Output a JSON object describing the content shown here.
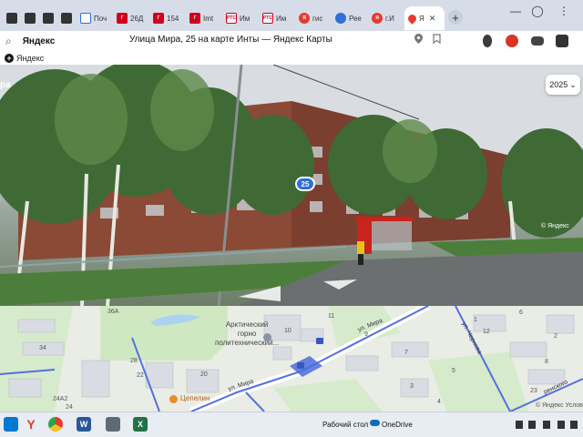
{
  "browser": {
    "tabs": [
      {
        "label": "",
        "icon": "grid-icon"
      },
      {
        "label": "",
        "icon": "grid-icon"
      },
      {
        "label": "",
        "icon": "grid-icon"
      },
      {
        "label": "",
        "icon": "grid-icon"
      },
      {
        "label": "Поч",
        "icon": "mail-icon"
      },
      {
        "label": "26Д",
        "icon": "doc-icon"
      },
      {
        "label": "154",
        "icon": "doc-icon"
      },
      {
        "label": "Imt",
        "icon": "doc-icon"
      },
      {
        "label": "Им",
        "icon": "rtc-icon"
      },
      {
        "label": "Им",
        "icon": "rtc-icon"
      },
      {
        "label": "гис",
        "icon": "yandex-icon"
      },
      {
        "label": "Рее",
        "icon": "globe-icon"
      },
      {
        "label": "г.И",
        "icon": "yandex-icon"
      }
    ],
    "active_tab": {
      "label": "Я",
      "close": "✕",
      "icon": "map-pin-icon"
    },
    "new_tab_symbol": "+",
    "window_controls": {
      "minimize": "—",
      "avatar": "◯",
      "more": "⋮"
    },
    "address": {
      "search_symbol": "⌕",
      "brand": "Яндекс",
      "title": "Улица Мира, 25 на карте Инты — Яндекс Карты"
    },
    "bookmarks": [
      {
        "label": "Яндекс"
      }
    ]
  },
  "street_view": {
    "partial_title": "ра",
    "year": "2025",
    "house_number": "25",
    "watermark": "© Яндекс"
  },
  "map": {
    "labels": [
      {
        "text": "36А"
      },
      {
        "text": "34"
      },
      {
        "text": "28"
      },
      {
        "text": "22"
      },
      {
        "text": "20"
      },
      {
        "text": "24А2"
      },
      {
        "text": "24"
      },
      {
        "text": "11"
      },
      {
        "text": "9"
      },
      {
        "text": "7"
      },
      {
        "text": "6"
      },
      {
        "text": "5"
      },
      {
        "text": "3"
      },
      {
        "text": "2"
      },
      {
        "text": "8"
      },
      {
        "text": "23"
      },
      {
        "text": "12"
      },
      {
        "text": "1"
      },
      {
        "text": "4"
      },
      {
        "text": "10"
      }
    ],
    "poi": {
      "line1": "Арктический",
      "line2": "горно",
      "line3": "политехнический..."
    },
    "cafe": "Цепелин",
    "streets": {
      "mira_top": "ул. Мира",
      "mira_bottom": "ул. Мира",
      "right": "ул. Чернова",
      "bottom_right": "ренского"
    },
    "footer": "© Яндекс  Услов",
    "marker_color": "#4a6cdb",
    "road_color": "#5470e0"
  },
  "taskbar": {
    "desktop_label": "Рабочий стол",
    "onedrive_label": "OneDrive",
    "apps": [
      "windows-icon",
      "yandex-browser-icon",
      "chrome-icon",
      "word-icon",
      "calculator-icon",
      "excel-icon"
    ]
  }
}
